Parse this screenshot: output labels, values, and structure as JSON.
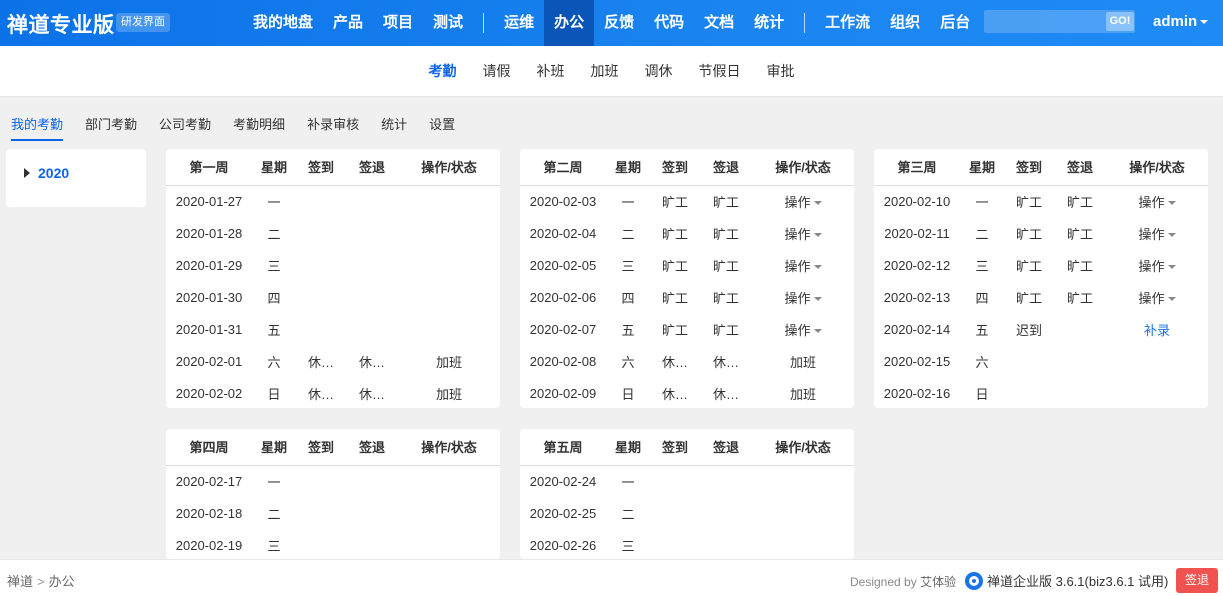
{
  "header": {
    "brand": "禅道专业版",
    "badge": "研发界面",
    "nav": [
      "我的地盘",
      "产品",
      "项目",
      "测试",
      "|",
      "运维",
      "办公",
      "反馈",
      "代码",
      "文档",
      "统计",
      "|",
      "工作流",
      "组织",
      "后台"
    ],
    "active_nav": "办公",
    "search_placeholder": "",
    "go_label": "GO!",
    "user": "admin"
  },
  "subnav": {
    "items": [
      "考勤",
      "请假",
      "补班",
      "加班",
      "调休",
      "节假日",
      "审批"
    ],
    "active": "考勤"
  },
  "modtabs": {
    "items": [
      "我的考勤",
      "部门考勤",
      "公司考勤",
      "考勤明细",
      "补录审核",
      "统计",
      "设置"
    ],
    "active": "我的考勤"
  },
  "sidebar": {
    "year": "2020"
  },
  "columns": [
    "星期",
    "签到",
    "签退",
    "操作/状态"
  ],
  "weeks": [
    {
      "title": "第一周",
      "rows": [
        {
          "date": "2020-01-27",
          "day": "一",
          "in": "",
          "out": "",
          "op": "",
          "style": "muted"
        },
        {
          "date": "2020-01-28",
          "day": "二",
          "in": "",
          "out": "",
          "op": "",
          "style": "muted"
        },
        {
          "date": "2020-01-29",
          "day": "三",
          "in": "",
          "out": "",
          "op": "",
          "style": "muted"
        },
        {
          "date": "2020-01-30",
          "day": "四",
          "in": "",
          "out": "",
          "op": "",
          "style": "muted"
        },
        {
          "date": "2020-01-31",
          "day": "五",
          "in": "",
          "out": "",
          "op": "",
          "style": "muted"
        },
        {
          "date": "2020-02-01",
          "day": "六",
          "in": "休…",
          "out": "休…",
          "op": "加班",
          "style": "rest"
        },
        {
          "date": "2020-02-02",
          "day": "日",
          "in": "休…",
          "out": "休…",
          "op": "加班",
          "style": "rest"
        }
      ]
    },
    {
      "title": "第二周",
      "rows": [
        {
          "date": "2020-02-03",
          "day": "一",
          "in": "旷工",
          "out": "旷工",
          "op": "操作",
          "style": "absent"
        },
        {
          "date": "2020-02-04",
          "day": "二",
          "in": "旷工",
          "out": "旷工",
          "op": "操作",
          "style": "absent"
        },
        {
          "date": "2020-02-05",
          "day": "三",
          "in": "旷工",
          "out": "旷工",
          "op": "操作",
          "style": "absent"
        },
        {
          "date": "2020-02-06",
          "day": "四",
          "in": "旷工",
          "out": "旷工",
          "op": "操作",
          "style": "absent"
        },
        {
          "date": "2020-02-07",
          "day": "五",
          "in": "旷工",
          "out": "旷工",
          "op": "操作",
          "style": "absent"
        },
        {
          "date": "2020-02-08",
          "day": "六",
          "in": "休…",
          "out": "休…",
          "op": "加班",
          "style": "rest"
        },
        {
          "date": "2020-02-09",
          "day": "日",
          "in": "休…",
          "out": "休…",
          "op": "加班",
          "style": "rest"
        }
      ]
    },
    {
      "title": "第三周",
      "rows": [
        {
          "date": "2020-02-10",
          "day": "一",
          "in": "旷工",
          "out": "旷工",
          "op": "操作",
          "style": "absent"
        },
        {
          "date": "2020-02-11",
          "day": "二",
          "in": "旷工",
          "out": "旷工",
          "op": "操作",
          "style": "absent"
        },
        {
          "date": "2020-02-12",
          "day": "三",
          "in": "旷工",
          "out": "旷工",
          "op": "操作",
          "style": "absent"
        },
        {
          "date": "2020-02-13",
          "day": "四",
          "in": "旷工",
          "out": "旷工",
          "op": "操作",
          "style": "absent"
        },
        {
          "date": "2020-02-14",
          "day": "五",
          "in": "迟到",
          "out": "",
          "op": "补录",
          "style": "late"
        },
        {
          "date": "2020-02-15",
          "day": "六",
          "in": "",
          "out": "",
          "op": "",
          "style": "plain"
        },
        {
          "date": "2020-02-16",
          "day": "日",
          "in": "",
          "out": "",
          "op": "",
          "style": "plain"
        }
      ]
    },
    {
      "title": "第四周",
      "rows": [
        {
          "date": "2020-02-17",
          "day": "一",
          "in": "",
          "out": "",
          "op": "",
          "style": "plain"
        },
        {
          "date": "2020-02-18",
          "day": "二",
          "in": "",
          "out": "",
          "op": "",
          "style": "plain"
        },
        {
          "date": "2020-02-19",
          "day": "三",
          "in": "",
          "out": "",
          "op": "",
          "style": "plain"
        }
      ]
    },
    {
      "title": "第五周",
      "rows": [
        {
          "date": "2020-02-24",
          "day": "一",
          "in": "",
          "out": "",
          "op": "",
          "style": "plain"
        },
        {
          "date": "2020-02-25",
          "day": "二",
          "in": "",
          "out": "",
          "op": "",
          "style": "plain"
        },
        {
          "date": "2020-02-26",
          "day": "三",
          "in": "",
          "out": "",
          "op": "",
          "style": "plain"
        }
      ]
    }
  ],
  "footer": {
    "breadcrumb": [
      "禅道",
      "办公"
    ],
    "designed_by_prefix": "Designed by",
    "designed_by_name": "艾体验",
    "version": "禅道企业版 3.6.1(biz3.6.1 试用)",
    "signout": "签退"
  },
  "colors": {
    "primary": "#0c64eb",
    "absent": "#f18b2c",
    "late": "#e43c3c",
    "rest": "#1a73e8",
    "signout": "#f0534f"
  }
}
